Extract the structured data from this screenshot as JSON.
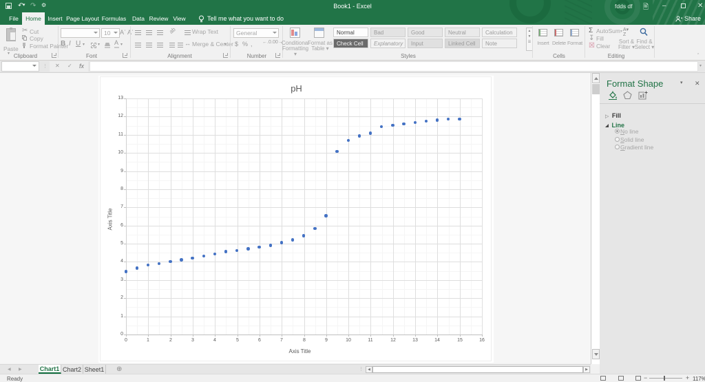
{
  "titlebar": {
    "title": "Book1 - Excel",
    "user": "fdds df"
  },
  "ribbon_tabs": [
    {
      "label": "File",
      "w": 24,
      "active": false
    },
    {
      "label": "Home",
      "w": 33,
      "active": true
    },
    {
      "label": "Insert",
      "w": 30,
      "active": false
    },
    {
      "label": "Page Layout",
      "w": 50,
      "active": false
    },
    {
      "label": "Formulas",
      "w": 41,
      "active": false
    },
    {
      "label": "Data",
      "w": 30,
      "active": false
    },
    {
      "label": "Review",
      "w": 29,
      "active": false
    },
    {
      "label": "View",
      "w": 31,
      "active": false
    }
  ],
  "tellme": "Tell me what you want to do",
  "share_label": "Share",
  "clipboard": {
    "group": "Clipboard",
    "paste": "Paste",
    "cut": "Cut",
    "copy": "Copy",
    "format_painter": "Format Painter"
  },
  "font_group": {
    "group": "Font",
    "font_name": "",
    "font_size": "10"
  },
  "alignment": {
    "group": "Alignment",
    "wrap": "Wrap Text",
    "merge": "Merge & Center"
  },
  "number": {
    "group": "Number",
    "format": "General"
  },
  "styles": {
    "group": "Styles",
    "cond": "Conditional Formatting",
    "fmt_table": "Format as Table",
    "row1": [
      {
        "label": "Normal",
        "bg": "#fdfdfd",
        "color": "#444444",
        "italic": false
      },
      {
        "label": "Bad",
        "bg": "#e3e3e3",
        "color": "#9b9b9b",
        "italic": false
      },
      {
        "label": "Good",
        "bg": "#e6e6e6",
        "color": "#9b9b9b",
        "italic": false
      },
      {
        "label": "Neutral",
        "bg": "#eaeaea",
        "color": "#9b9b9b",
        "italic": false
      },
      {
        "label": "Calculation",
        "bg": "#f2f2f2",
        "color": "#9b9b9b",
        "italic": false
      }
    ],
    "row2": [
      {
        "label": "Check Cell",
        "bg": "#6b6b6b",
        "color": "#f5f5f5",
        "italic": false
      },
      {
        "label": "Explanatory ...",
        "bg": "#f2f2f2",
        "color": "#9b9b9b",
        "italic": true
      },
      {
        "label": "Input",
        "bg": "#e0e0e0",
        "color": "#9b9b9b",
        "italic": false
      },
      {
        "label": "Linked Cell",
        "bg": "#d8d8d8",
        "color": "#9b9b9b",
        "italic": false
      },
      {
        "label": "Note",
        "bg": "#f0f0f0",
        "color": "#9b9b9b",
        "italic": false
      }
    ]
  },
  "cells_group": {
    "group": "Cells",
    "items": [
      "Insert",
      "Delete",
      "Format"
    ]
  },
  "editing": {
    "group": "Editing",
    "autosum": "AutoSum",
    "fill": "Fill",
    "clear": "Clear",
    "sort": "Sort &",
    "filter": "Filter",
    "find": "Find &",
    "select": "Select"
  },
  "chart_data": {
    "type": "scatter",
    "title": "pH",
    "xlabel": "Axis Title",
    "ylabel": "Axis Title",
    "xlim": [
      0,
      16
    ],
    "ylim": [
      0,
      13
    ],
    "x_major": 1,
    "y_major": 1,
    "x_minor": 0.5,
    "y_minor": 0.5,
    "grid": true,
    "point_color": "#4472c4",
    "x": [
      0,
      0.5,
      1,
      1.5,
      2,
      2.5,
      3,
      3.5,
      4,
      4.5,
      5,
      5.5,
      6,
      6.5,
      7,
      7.5,
      8,
      8.5,
      9,
      9.5,
      10,
      10.5,
      11,
      11.5,
      12,
      12.5,
      13,
      13.5,
      14,
      14.5,
      15
    ],
    "y": [
      3.45,
      3.65,
      3.82,
      3.9,
      4.0,
      4.1,
      4.2,
      4.32,
      4.42,
      4.55,
      4.62,
      4.7,
      4.8,
      4.9,
      5.05,
      5.2,
      5.42,
      5.82,
      6.52,
      10.07,
      10.68,
      10.92,
      11.08,
      11.43,
      11.5,
      11.58,
      11.66,
      11.73,
      11.79,
      11.85,
      11.86
    ]
  },
  "pane": {
    "title": "Format Shape",
    "sections": {
      "fill": "Fill",
      "line": "Line"
    },
    "options": [
      "No line",
      "Solid line",
      "Gradient line"
    ],
    "selected_option": "No line"
  },
  "sheet_tabs": [
    {
      "label": "Chart1",
      "active": true
    },
    {
      "label": "Chart2",
      "active": false
    },
    {
      "label": "Sheet1",
      "active": false
    }
  ],
  "status": {
    "ready": "Ready",
    "zoom": "117%"
  }
}
